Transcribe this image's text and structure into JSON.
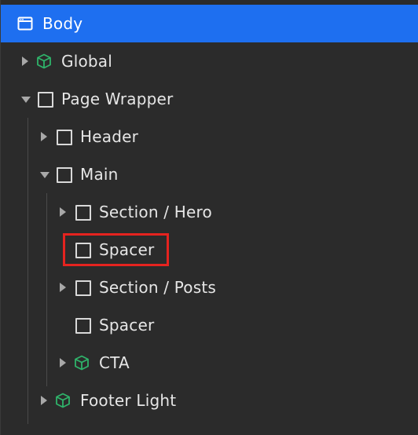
{
  "tree": {
    "body": "Body",
    "global": "Global",
    "page_wrapper": "Page Wrapper",
    "header": "Header",
    "main": "Main",
    "section_hero": "Section / Hero",
    "spacer_1": "Spacer",
    "section_posts": "Section / Posts",
    "spacer_2": "Spacer",
    "cta": "CTA",
    "footer_light": "Footer Light"
  },
  "colors": {
    "selected_bg": "#1e6ff0",
    "component_icon": "#2fb36a",
    "highlight_border": "#e5231f"
  },
  "icons": {
    "body": "window-icon",
    "component": "cube-icon",
    "element": "square-icon"
  }
}
